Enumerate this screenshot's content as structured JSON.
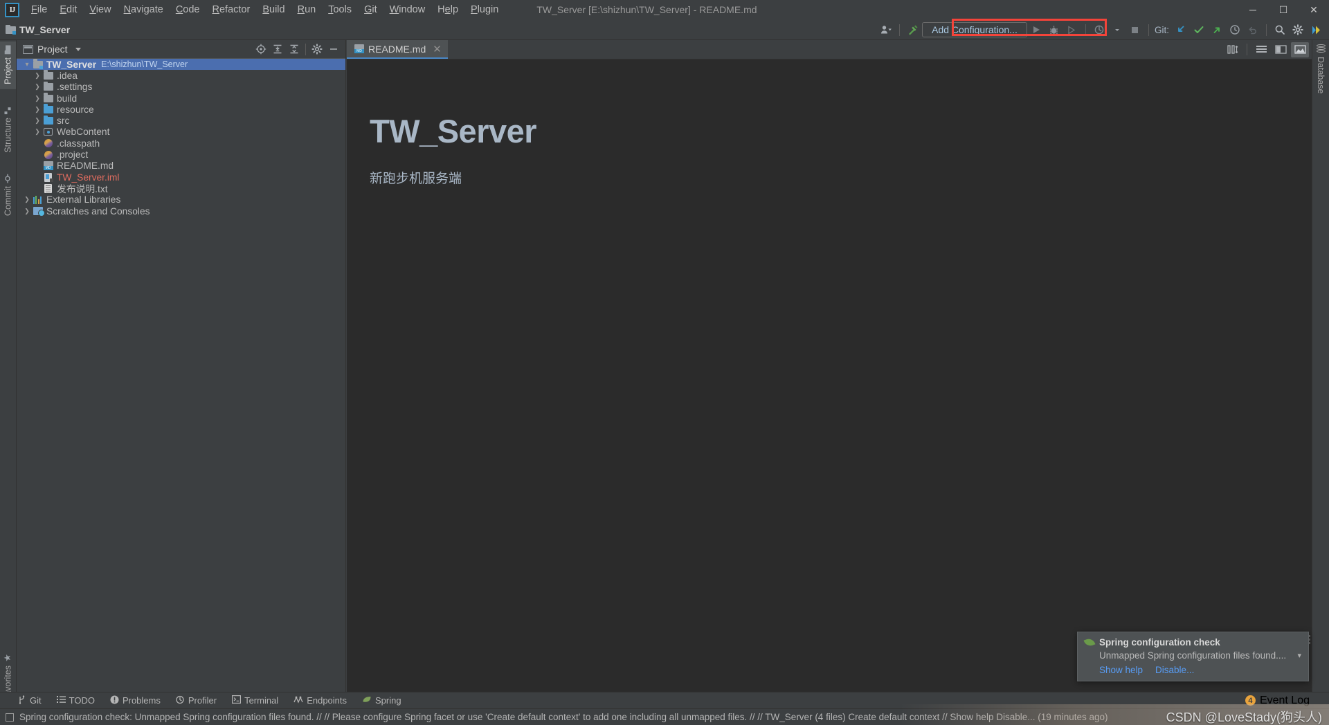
{
  "window": {
    "title": "TW_Server [E:\\shizhun\\TW_Server] - README.md",
    "minimize": "─",
    "maximize": "☐",
    "close": "✕"
  },
  "menubar": {
    "logo": "IJ",
    "items": [
      {
        "pre": "",
        "mn": "F",
        "post": "ile"
      },
      {
        "pre": "",
        "mn": "E",
        "post": "dit"
      },
      {
        "pre": "",
        "mn": "V",
        "post": "iew"
      },
      {
        "pre": "",
        "mn": "N",
        "post": "avigate"
      },
      {
        "pre": "",
        "mn": "C",
        "post": "ode"
      },
      {
        "pre": "",
        "mn": "R",
        "post": "efactor"
      },
      {
        "pre": "",
        "mn": "B",
        "post": "uild"
      },
      {
        "pre": "",
        "mn": "R",
        "post": "un"
      },
      {
        "pre": "",
        "mn": "T",
        "post": "ools"
      },
      {
        "pre": "",
        "mn": "G",
        "post": "it"
      },
      {
        "pre": "",
        "mn": "W",
        "post": "indow"
      },
      {
        "pre": "H",
        "mn": "e",
        "post": "lp"
      },
      {
        "pre": "",
        "mn": "P",
        "post": "lugin"
      }
    ]
  },
  "navbar": {
    "breadcrumb": "TW_Server",
    "add_configuration_label": "Add Configuration...",
    "git_label": "Git:"
  },
  "left_stripe": {
    "project": "Project",
    "structure": "Structure",
    "commit": "Commit",
    "favorites": "Favorites"
  },
  "right_stripe": {
    "database": "Database"
  },
  "project_panel": {
    "title": "Project",
    "tree": [
      {
        "label": "TW_Server",
        "path": "E:\\shizhun\\TW_Server",
        "icon": "module-folder-icon",
        "indent": 0,
        "arrow": "open",
        "selected": true,
        "bold": true
      },
      {
        "label": ".idea",
        "path": "",
        "icon": "folder-gray-icon",
        "indent": 1,
        "arrow": "closed",
        "selected": false,
        "bold": false
      },
      {
        "label": ".settings",
        "path": "",
        "icon": "folder-gray-icon",
        "indent": 1,
        "arrow": "closed",
        "selected": false,
        "bold": false
      },
      {
        "label": "build",
        "path": "",
        "icon": "folder-gray-icon",
        "indent": 1,
        "arrow": "closed",
        "selected": false,
        "bold": false
      },
      {
        "label": "resource",
        "path": "",
        "icon": "folder-blue-icon",
        "indent": 1,
        "arrow": "closed",
        "selected": false,
        "bold": false
      },
      {
        "label": "src",
        "path": "",
        "icon": "folder-blue-icon",
        "indent": 1,
        "arrow": "closed",
        "selected": false,
        "bold": false
      },
      {
        "label": "WebContent",
        "path": "",
        "icon": "web-folder-icon",
        "indent": 1,
        "arrow": "closed",
        "selected": false,
        "bold": false
      },
      {
        "label": ".classpath",
        "path": "",
        "icon": "eclipse-file-icon",
        "indent": 1,
        "arrow": "none",
        "selected": false,
        "bold": false
      },
      {
        "label": ".project",
        "path": "",
        "icon": "eclipse-file-icon",
        "indent": 1,
        "arrow": "none",
        "selected": false,
        "bold": false
      },
      {
        "label": "README.md",
        "path": "",
        "icon": "markdown-file-icon",
        "indent": 1,
        "arrow": "none",
        "selected": false,
        "bold": false
      },
      {
        "label": "TW_Server.iml",
        "path": "",
        "icon": "iml-file-icon",
        "indent": 1,
        "arrow": "none",
        "selected": false,
        "bold": false,
        "red": true
      },
      {
        "label": "发布说明.txt",
        "path": "",
        "icon": "text-file-icon",
        "indent": 1,
        "arrow": "none",
        "selected": false,
        "bold": false
      },
      {
        "label": "External Libraries",
        "path": "",
        "icon": "libraries-icon",
        "indent": 0,
        "arrow": "closed",
        "selected": false,
        "bold": false
      },
      {
        "label": "Scratches and Consoles",
        "path": "",
        "icon": "scratches-icon",
        "indent": 0,
        "arrow": "closed",
        "selected": false,
        "bold": false
      }
    ]
  },
  "editor": {
    "tab_label": "README.md",
    "tab_close": "✕",
    "markdown": {
      "heading": "TW_Server",
      "paragraph": "新跑步机服务端"
    }
  },
  "notification": {
    "title": "Spring configuration check",
    "message": "Unmapped Spring configuration files found....",
    "links": [
      "Show help",
      "Disable..."
    ]
  },
  "bottom_tools": {
    "items": [
      {
        "label": "Git",
        "icon": "git-branch-icon"
      },
      {
        "label": "TODO",
        "icon": "todo-list-icon"
      },
      {
        "label": "Problems",
        "icon": "problems-icon"
      },
      {
        "label": "Profiler",
        "icon": "profiler-icon"
      },
      {
        "label": "Terminal",
        "icon": "terminal-icon"
      },
      {
        "label": "Endpoints",
        "icon": "endpoints-icon"
      },
      {
        "label": "Spring",
        "icon": "spring-leaf-icon"
      }
    ],
    "event_log": "Event Log",
    "event_log_count": "4"
  },
  "statusbar": {
    "message": "Spring configuration check: Unmapped Spring configuration files found. // // Please configure Spring facet or use 'Create default context' to add one including all unmapped files. // // TW_Server (4 files)    Create default context // Show help    Disable... (19 minutes ago)",
    "watermark": "CSDN @LoveStady(狗头人)"
  },
  "colors": {
    "accent": "#4b6eaf",
    "highlight_box": "#f4443a",
    "link": "#589df6",
    "editor_bg": "#2b2b2b",
    "panel_bg": "#3c3f41"
  }
}
